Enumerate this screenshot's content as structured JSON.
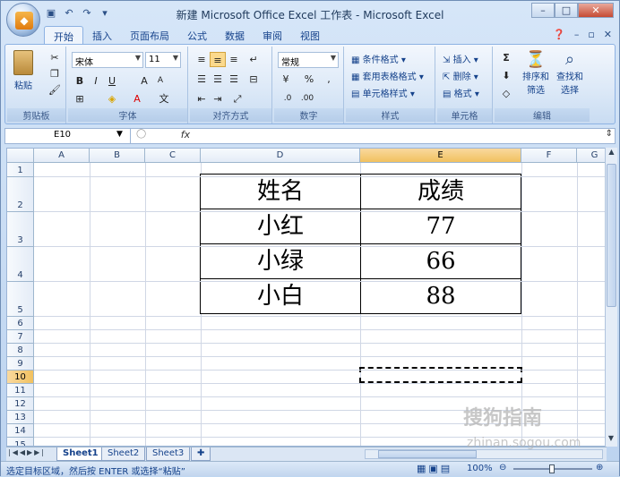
{
  "window": {
    "title": "新建 Microsoft Office Excel 工作表 - Microsoft Excel"
  },
  "tabs": [
    "开始",
    "插入",
    "页面布局",
    "公式",
    "数据",
    "审阅",
    "视图"
  ],
  "ribbon": {
    "clipboard": {
      "paste": "粘贴",
      "label": "剪贴板"
    },
    "font": {
      "name": "宋体",
      "size": "11",
      "label": "字体"
    },
    "alignment": {
      "label": "对齐方式"
    },
    "number": {
      "format": "常规",
      "label": "数字"
    },
    "styles": {
      "cond": "条件格式",
      "table": "套用表格格式",
      "cell": "单元格样式",
      "label": "样式"
    },
    "cells": {
      "insert": "插入",
      "delete": "删除",
      "format": "格式",
      "label": "单元格"
    },
    "editing": {
      "sort1": "排序和",
      "sort2": "筛选",
      "find1": "查找和",
      "find2": "选择",
      "label": "编辑"
    }
  },
  "formula_bar": {
    "namebox": "E10",
    "fx": "fx",
    "formula": ""
  },
  "columns": [
    "A",
    "B",
    "C",
    "D",
    "E",
    "F",
    "G"
  ],
  "rows": [
    "1",
    "2",
    "3",
    "4",
    "5",
    "6",
    "7",
    "8",
    "9",
    "10",
    "11",
    "12",
    "13",
    "14",
    "15"
  ],
  "table": {
    "header": [
      "姓名",
      "成绩"
    ],
    "rows": [
      [
        "小红",
        "77"
      ],
      [
        "小绿",
        "66"
      ],
      [
        "小白",
        "88"
      ]
    ]
  },
  "sheets": [
    "Sheet1",
    "Sheet2",
    "Sheet3"
  ],
  "status": {
    "text": "选定目标区域，然后按 ENTER 或选择“粘贴”",
    "zoom": "100%"
  },
  "watermark": {
    "line1": "搜狗指南",
    "line2": "zhinan.sogou.com"
  }
}
